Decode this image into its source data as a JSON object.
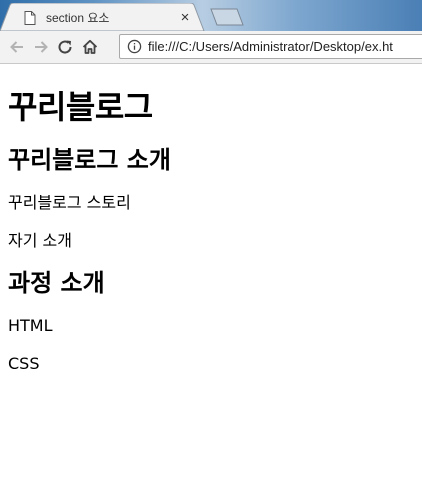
{
  "browser": {
    "tab_title": "section 요소",
    "tab_close": "×",
    "address": "file:///C:/Users/Administrator/Desktop/ex.ht"
  },
  "page": {
    "h1": "꾸리블로그",
    "section1": {
      "heading": "꾸리블로그 소개",
      "items": [
        "꾸리블로그 스토리",
        "자기 소개"
      ]
    },
    "section2": {
      "heading": "과정 소개",
      "items": [
        "HTML",
        "CSS"
      ]
    }
  }
}
